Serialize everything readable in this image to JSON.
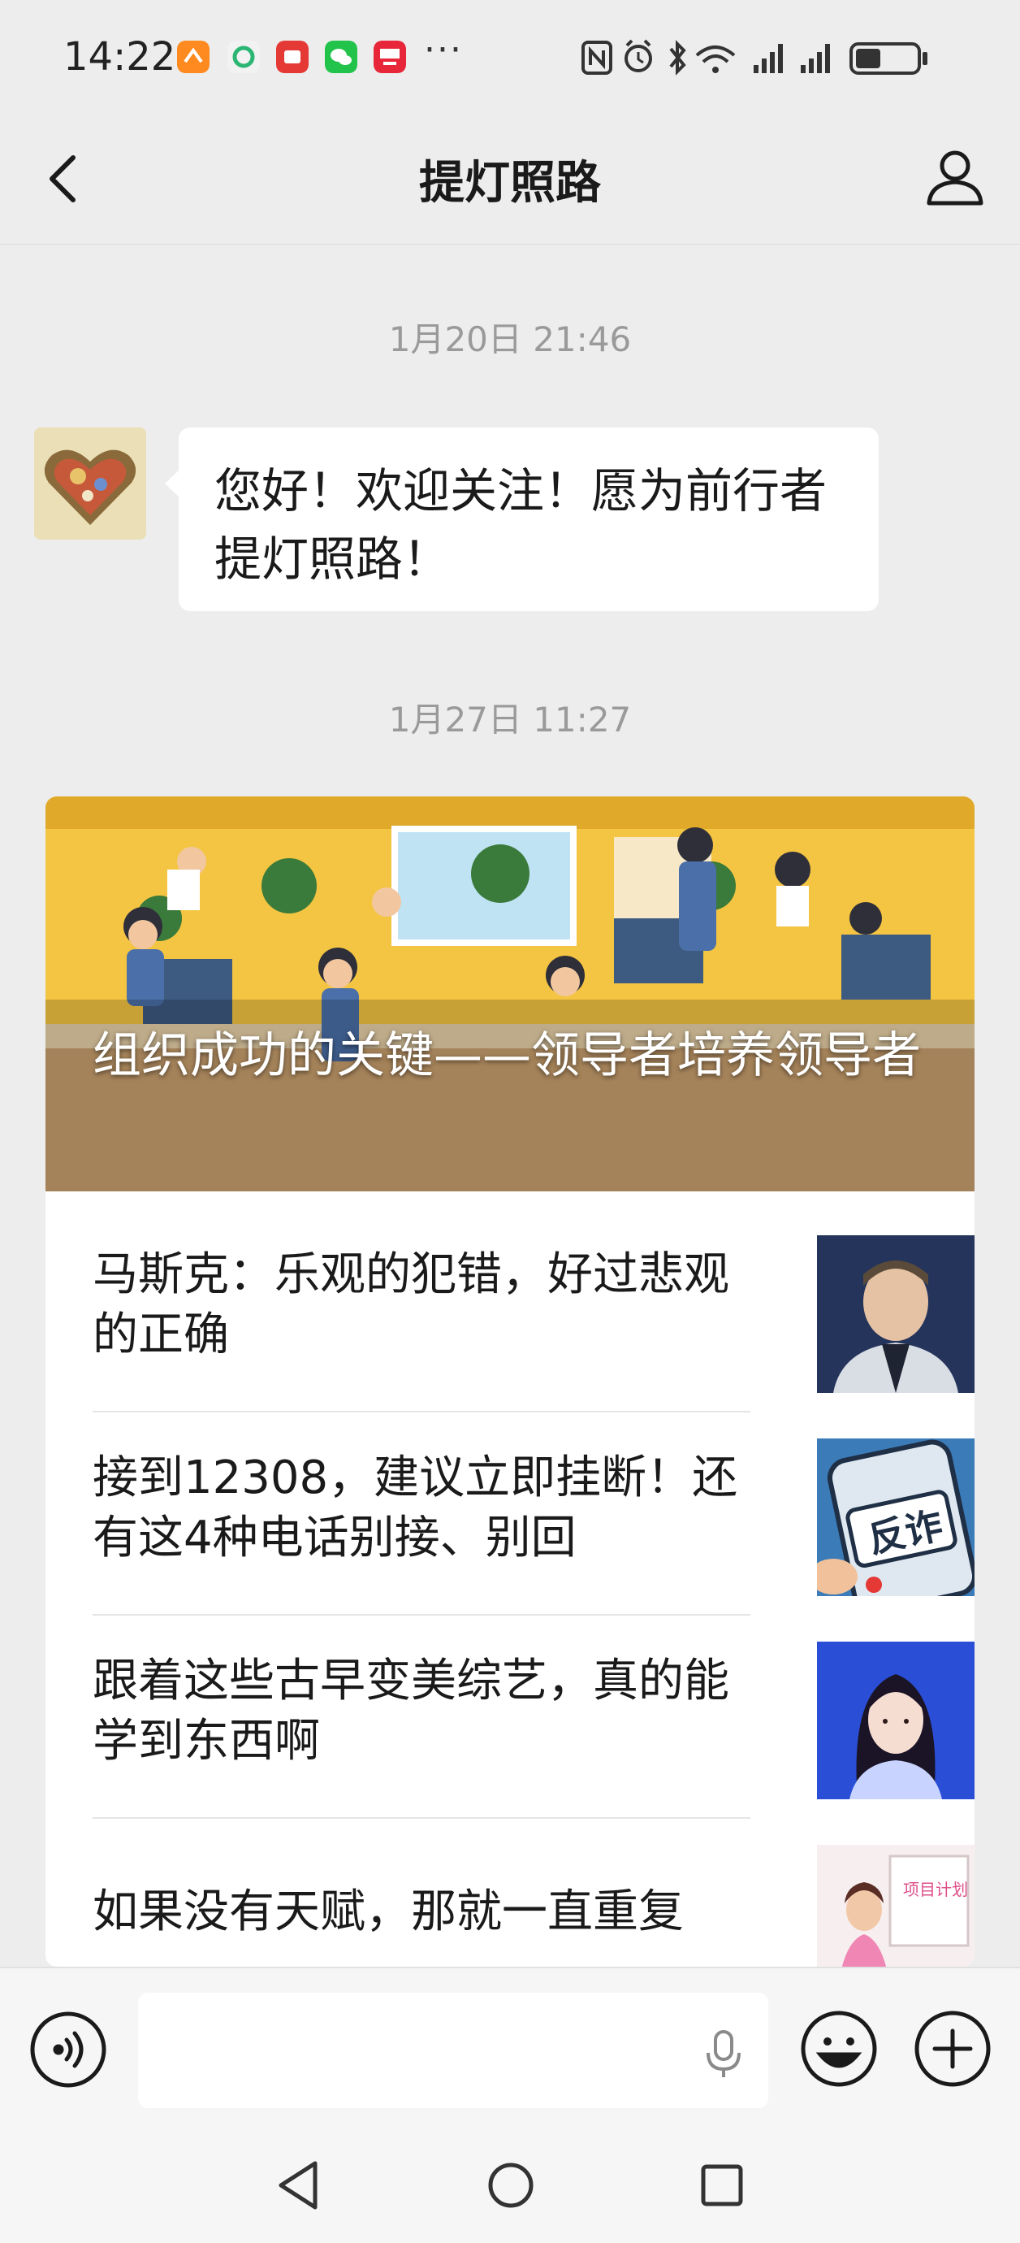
{
  "status_bar": {
    "time": "14:22",
    "app_icons": [
      {
        "name": "taobao-app-icon",
        "color": "#ff8a1f"
      },
      {
        "name": "feishu-app-icon",
        "color": "#2bb673"
      },
      {
        "name": "notes-app-icon",
        "color": "#e53935"
      },
      {
        "name": "wechat-app-icon",
        "color": "#21c34a"
      },
      {
        "name": "promo-app-icon",
        "color": "#e8263a"
      }
    ],
    "more": "···",
    "icons": [
      "nfc-icon",
      "alarm-icon",
      "bluetooth-icon",
      "wifi-icon",
      "signal-1-icon",
      "signal-2-icon",
      "battery-icon"
    ]
  },
  "nav": {
    "title": "提灯照路",
    "back_icon": "chevron-left-icon",
    "profile_icon": "person-icon"
  },
  "chat": {
    "timestamp_1": "1月20日 21:46",
    "greeting": "您好！欢迎关注！愿为前行者提灯照路！",
    "timestamp_2": "1月27日 11:27"
  },
  "card": {
    "cover_title": "组织成功的关键——领导者培养领导者",
    "articles": [
      {
        "title": "马斯克：乐观的犯错，好过悲观的正确",
        "thumb": "portrait-thumbnail"
      },
      {
        "title": "接到12308，建议立即挂断！还有这4种电话别接、别回",
        "thumb": "anti-fraud-thumbnail",
        "thumb_text": "反诈"
      },
      {
        "title": "跟着这些古早变美综艺，真的能学到东西啊",
        "thumb": "girl-illustration-thumbnail"
      },
      {
        "title": "如果没有天赋，那就一直重复",
        "thumb": "presentation-thumbnail",
        "thumb_text": "项目计划"
      }
    ]
  },
  "input_bar": {
    "voice_icon": "voice-toggle-icon",
    "mic_icon": "mic-icon",
    "emoji_icon": "emoji-icon",
    "plus_icon": "plus-icon"
  },
  "system_nav": [
    "back-triangle-icon",
    "home-circle-icon",
    "recents-square-icon"
  ],
  "colors": {
    "background": "#ededed",
    "bubble": "#ffffff",
    "timestamp": "#9a9a9a",
    "input_bar": "#f6f6f6"
  }
}
